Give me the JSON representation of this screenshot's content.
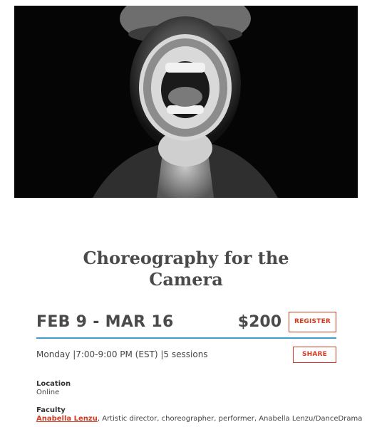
{
  "hero": {
    "alt": "photo of a person holding a large cartoon-mouth prop in front of their face"
  },
  "course": {
    "title_line1": "Choreography for the",
    "title_line2": "Camera",
    "dates": "FEB 9 - MAR 16",
    "price": "$200",
    "schedule": "Monday |7:00-9:00 PM (EST) |5 sessions"
  },
  "actions": {
    "register_label": "REGISTER",
    "share_label": "SHARE"
  },
  "location": {
    "label": "Location",
    "value": "Online"
  },
  "faculty": {
    "label": "Faculty",
    "name": "Anabella Lenzu",
    "description": ", Artistic director, choreographer, performer, Anabella Lenzu/DanceDrama"
  },
  "colors": {
    "accent": "#d33a20",
    "rule": "#3aa0c9",
    "text": "#4a4a4a"
  }
}
